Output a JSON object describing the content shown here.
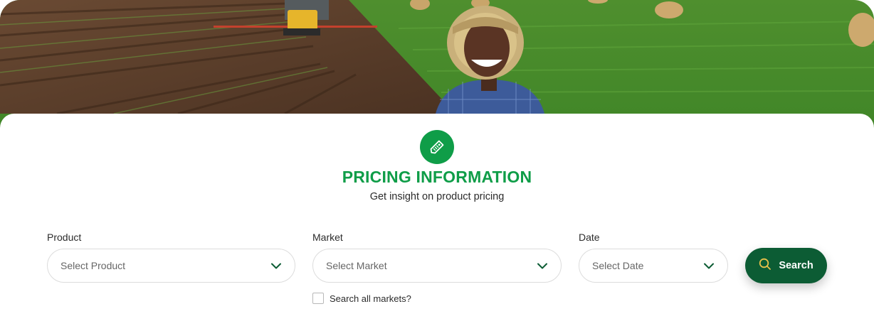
{
  "hero": {
    "image": "farmer-in-field-photo"
  },
  "section": {
    "icon": "price-tag-icon",
    "title": "PRICING INFORMATION",
    "subtitle": "Get insight on product pricing"
  },
  "filters": {
    "product": {
      "label": "Product",
      "placeholder": "Select Product"
    },
    "market": {
      "label": "Market",
      "placeholder": "Select Market"
    },
    "date": {
      "label": "Date",
      "placeholder": "Select Date"
    },
    "search_all_markets": {
      "label": "Search all markets?",
      "checked": false
    },
    "search_button": {
      "label": "Search",
      "icon": "search-icon"
    }
  },
  "colors": {
    "accent_green": "#0f9d48",
    "button_dark_green": "#0c5c34",
    "chevron_green": "#0c5c34"
  }
}
